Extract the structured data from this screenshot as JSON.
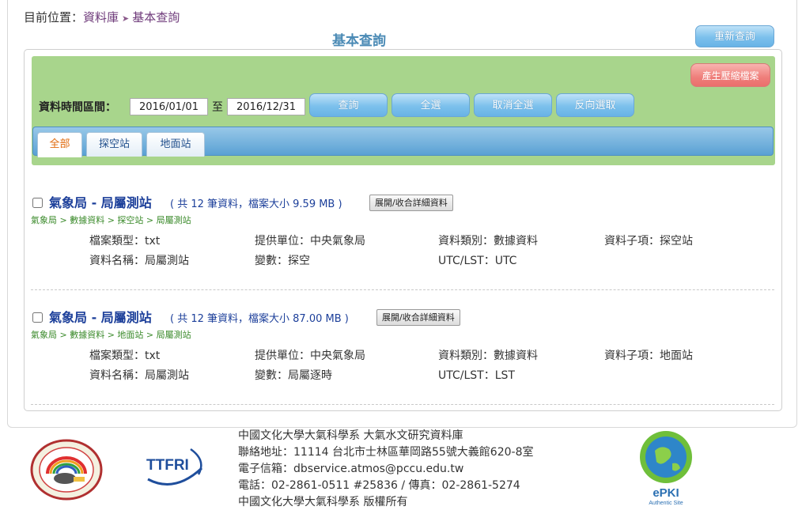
{
  "breadcrumb": {
    "prefix": "目前位置：",
    "level1": "資料庫",
    "sep": "➤",
    "level2": "基本查詢"
  },
  "page_title": "基本查詢",
  "reset_button": "重新查詢",
  "toolbar": {
    "zip_button": "產生壓縮檔案",
    "time_label": "資料時間區間：",
    "start_date": "2016/01/01",
    "to_label": "至",
    "end_date": "2016/12/31",
    "query_button": "查詢",
    "select_all_button": "全選",
    "deselect_all_button": "取消全選",
    "invert_button": "反向選取"
  },
  "tabs": [
    {
      "label": "全部",
      "active": true
    },
    {
      "label": "探空站",
      "active": false
    },
    {
      "label": "地面站",
      "active": false
    }
  ],
  "records": [
    {
      "title": "氣象局 - 局屬測站",
      "info": "( 共 12 筆資料，檔案大小 9.59 MB )",
      "toggle_button": "展開/收合詳細資料",
      "path": "氣象局 > 數據資料 > 探空站 > 局屬測站",
      "fields": {
        "file_type": "檔案類型：txt",
        "provider": "提供單位：中央氣象局",
        "category": "資料類別：數據資料",
        "subitem": "資料子項：探空站",
        "name": "資料名稱：局屬測站",
        "variable": "變數：探空",
        "utc_lst": "UTC/LST：UTC"
      }
    },
    {
      "title": "氣象局 - 局屬測站",
      "info": "( 共 12 筆資料，檔案大小 87.00 MB )",
      "toggle_button": "展開/收合詳細資料",
      "path": "氣象局 > 數據資料 > 地面站 > 局屬測站",
      "fields": {
        "file_type": "檔案類型：txt",
        "provider": "提供單位：中央氣象局",
        "category": "資料類別：數據資料",
        "subitem": "資料子項：地面站",
        "name": "資料名稱：局屬測站",
        "variable": "變數：局屬逐時",
        "utc_lst": "UTC/LST：LST"
      }
    }
  ],
  "footer": {
    "lines": [
      "中國文化大學大氣科學系 大氣水文研究資料庫",
      "聯絡地址：11114 台北市士林區華岡路55號大義館620-8室",
      "電子信箱：dbservice.atmos@pccu.edu.tw",
      "電話：02-2861-0511 #25836 / 傳真：02-2861-5274",
      "中國文化大學大氣科學系 版權所有"
    ],
    "logo_ttfri": "TTFRI",
    "logo_epki": "ePKI",
    "logo_epki_sub": "Authentic Site"
  },
  "colors": {
    "accent_blue": "#7cc0ec",
    "toolbar_green": "#a8d58c",
    "title_blue": "#1c3f9a",
    "path_green": "#3a8a2a"
  }
}
